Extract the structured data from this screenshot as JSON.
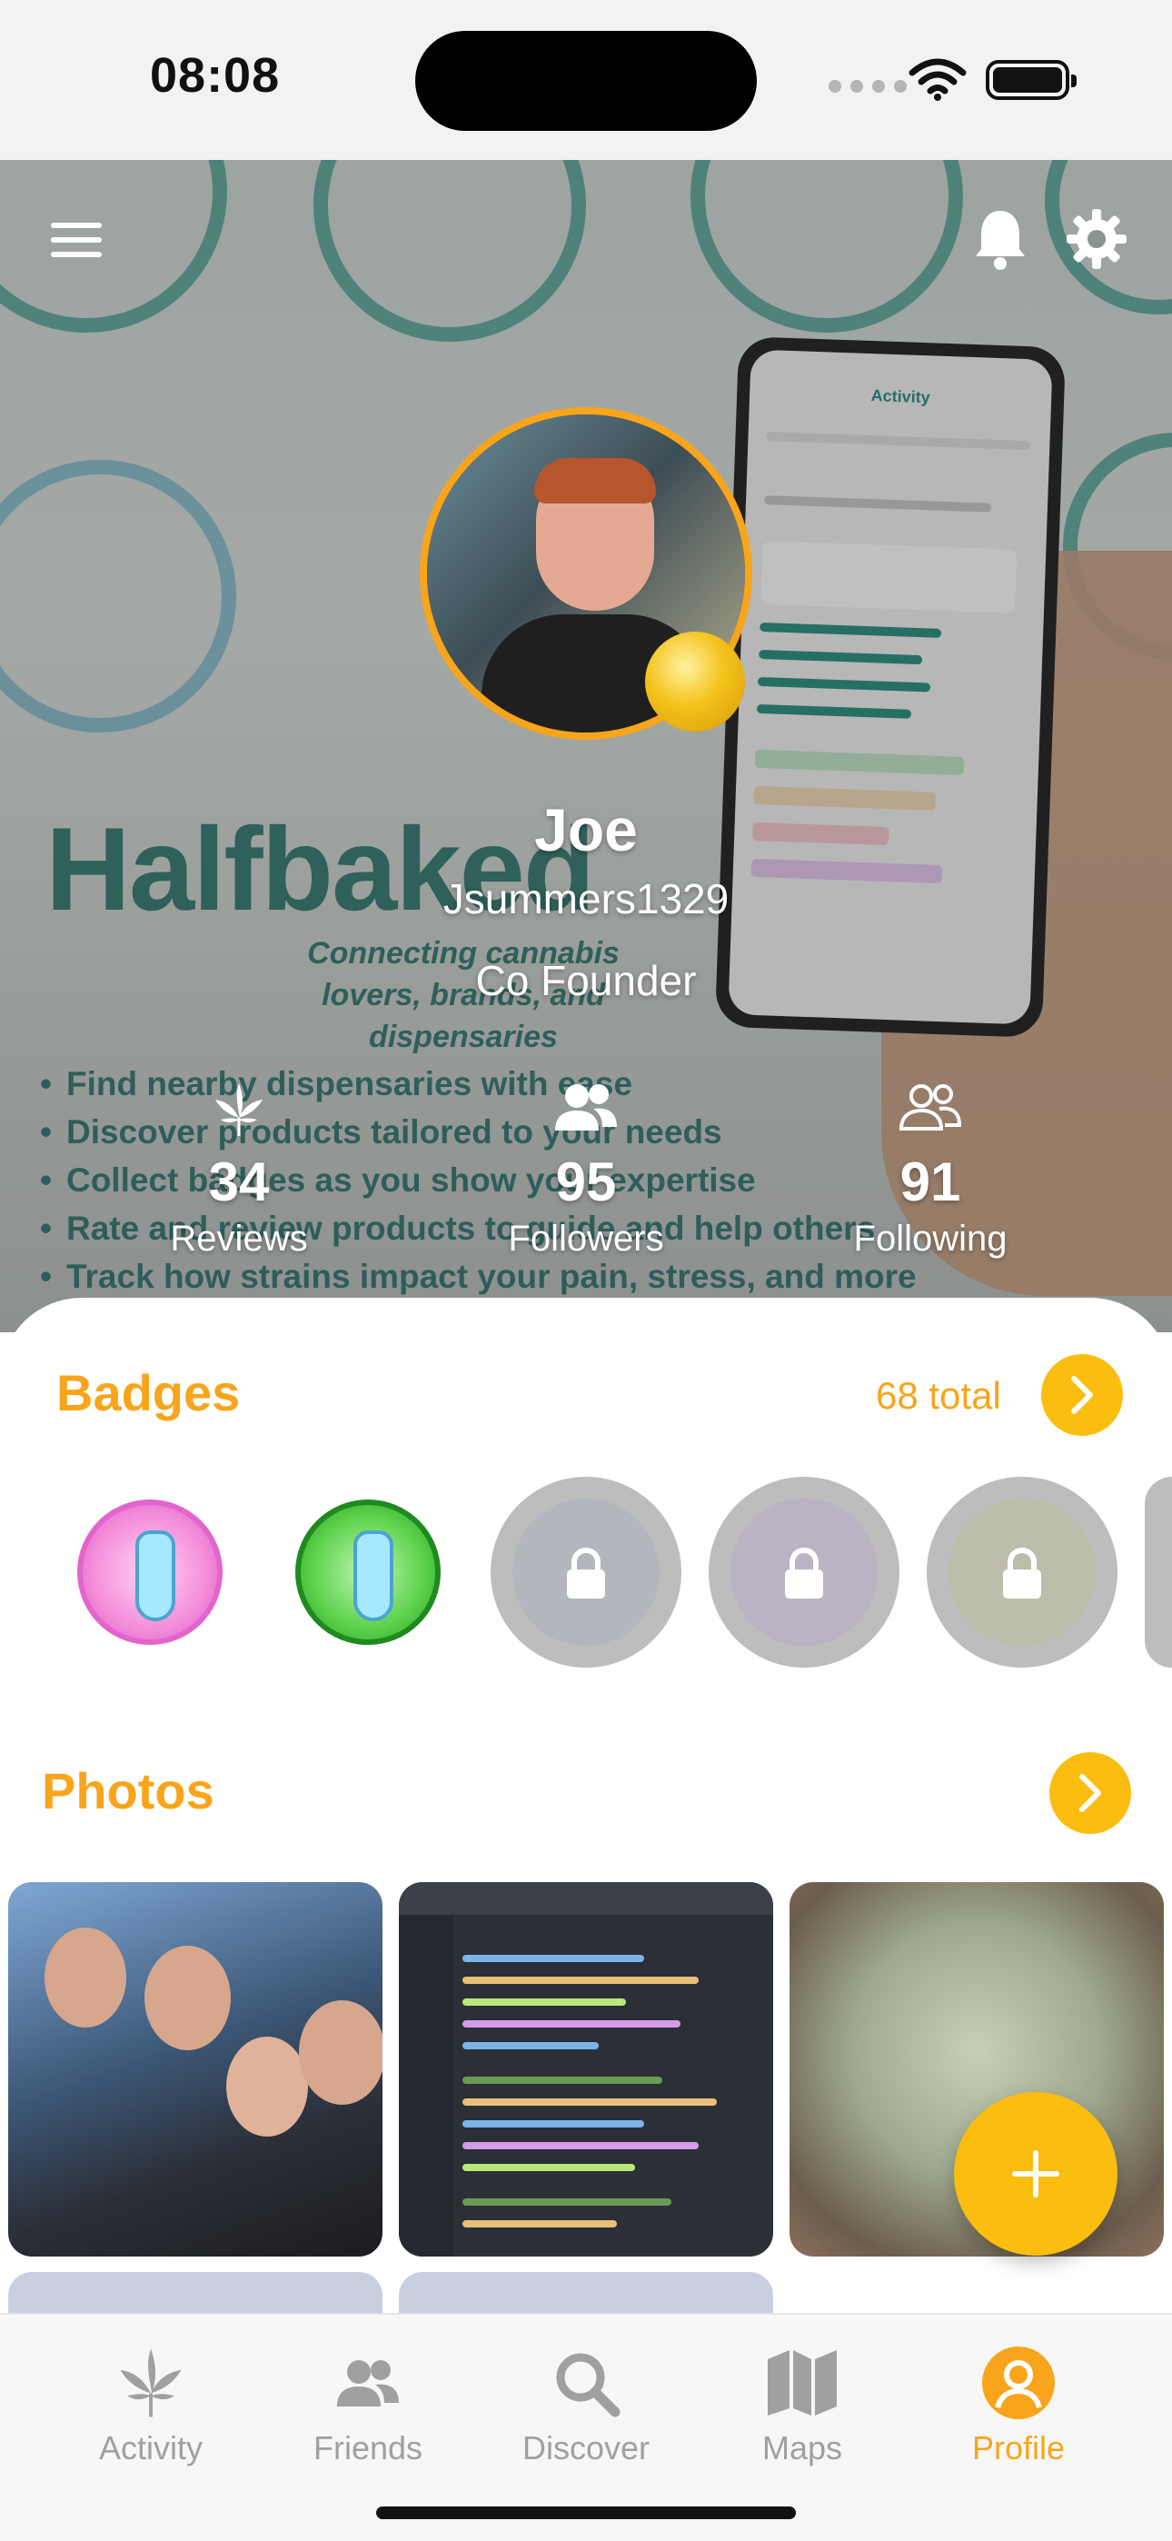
{
  "status_bar": {
    "time": "08:08"
  },
  "hero": {
    "brand": "Halfbaked",
    "brand_tagline": "Connecting cannabis lovers, brands, and dispensaries",
    "features": [
      "Find nearby dispensaries with ease",
      "Discover products tailored to your needs",
      "Collect badges as you show your expertise",
      "Rate and review products to guide and help others",
      "Track how strains impact your pain, stress, and more"
    ],
    "phone_title": "Activity"
  },
  "profile": {
    "name": "Joe",
    "username": "Jsummers1329",
    "role": "Co Founder",
    "stats": [
      {
        "icon": "leaf-icon",
        "value": "34",
        "label": "Reviews"
      },
      {
        "icon": "users-icon",
        "value": "95",
        "label": "Followers"
      },
      {
        "icon": "users-outline-icon",
        "value": "91",
        "label": "Following"
      }
    ]
  },
  "badges": {
    "title": "Badges",
    "total": "68 total"
  },
  "photos": {
    "title": "Photos"
  },
  "tabs": [
    {
      "label": "Activity",
      "icon": "leaf-icon",
      "active": false
    },
    {
      "label": "Friends",
      "icon": "users-icon",
      "active": false
    },
    {
      "label": "Discover",
      "icon": "search-icon",
      "active": false
    },
    {
      "label": "Maps",
      "icon": "map-icon",
      "active": false
    },
    {
      "label": "Profile",
      "icon": "user-icon",
      "active": true
    }
  ],
  "colors": {
    "accent": "#f8a51c",
    "accent_button": "#fbbd0f",
    "brand_teal": "#1e6b62"
  }
}
